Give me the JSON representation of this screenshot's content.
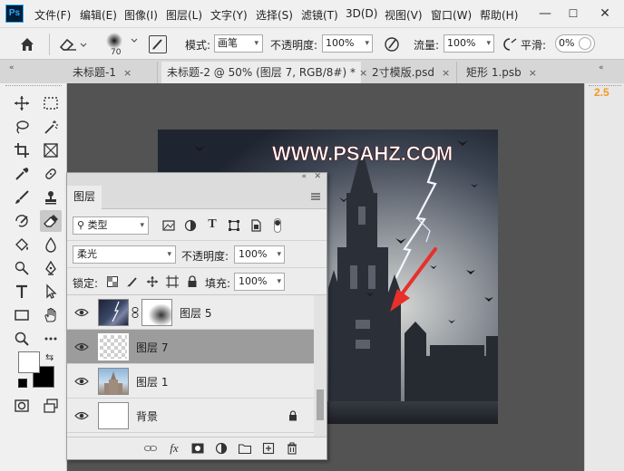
{
  "app": {
    "logo_text": "Ps"
  },
  "menu": [
    {
      "label": "文件(F)"
    },
    {
      "label": "编辑(E)"
    },
    {
      "label": "图像(I)"
    },
    {
      "label": "图层(L)"
    },
    {
      "label": "文字(Y)"
    },
    {
      "label": "选择(S)"
    },
    {
      "label": "滤镜(T)"
    },
    {
      "label": "3D(D)"
    },
    {
      "label": "视图(V)"
    },
    {
      "label": "窗口(W)"
    },
    {
      "label": "帮助(H)"
    }
  ],
  "window_controls": {
    "minimize": "—",
    "maximize": "☐",
    "close": "✕"
  },
  "options": {
    "brush_size": "70",
    "mode_label": "模式:",
    "mode_value": "画笔",
    "opacity_label": "不透明度:",
    "opacity_value": "100%",
    "flow_label": "流量:",
    "flow_value": "100%",
    "smoothing_label": "平滑:",
    "smoothing_value": "0%"
  },
  "tabs": [
    {
      "label": "未标题-1",
      "active": false
    },
    {
      "label": "未标题-2 @ 50% (图层 7, RGB/8#) *",
      "active": true
    },
    {
      "label": "2寸模版.psd",
      "active": false
    },
    {
      "label": "矩形 1.psb",
      "active": false
    }
  ],
  "tab_close_glyph": "×",
  "right_panel": {
    "value": "2.5",
    "accent": "#f29a1c"
  },
  "canvas": {
    "watermark": "WWW.PSAHZ.COM",
    "arrow_color": "#e8302a"
  },
  "layers_panel": {
    "tab_label": "图层",
    "filter_type": "类型",
    "blend_mode": "柔光",
    "opacity_label": "不透明度:",
    "opacity_value": "100%",
    "lock_label": "锁定:",
    "fill_label": "填充:",
    "fill_value": "100%",
    "layers": [
      {
        "name": "图层 5",
        "selected": false,
        "has_mask": true
      },
      {
        "name": "图层 7",
        "selected": true,
        "has_mask": false
      },
      {
        "name": "图层 1",
        "selected": false,
        "has_mask": false
      },
      {
        "name": "背景",
        "selected": false,
        "has_mask": false,
        "locked": true
      }
    ],
    "footer_fx": "fx"
  },
  "colors": {
    "foreground": "#ffffff",
    "background": "#000000",
    "selected_row": "#9c9c9c"
  },
  "tools": [
    "move-tool-icon",
    "marquee-tool-icon",
    "lasso-tool-icon",
    "magic-wand-icon",
    "crop-tool-icon",
    "frame-tool-icon",
    "eyedropper-icon",
    "healing-brush-icon",
    "brush-tool-icon",
    "clone-stamp-icon",
    "history-brush-icon",
    "eraser-tool-icon",
    "paint-bucket-icon",
    "blur-tool-icon",
    "dodge-tool-icon",
    "pen-tool-icon",
    "type-tool-icon",
    "path-selection-icon",
    "rectangle-tool-icon",
    "hand-tool-icon",
    "zoom-tool-icon",
    "more-tools-icon"
  ]
}
